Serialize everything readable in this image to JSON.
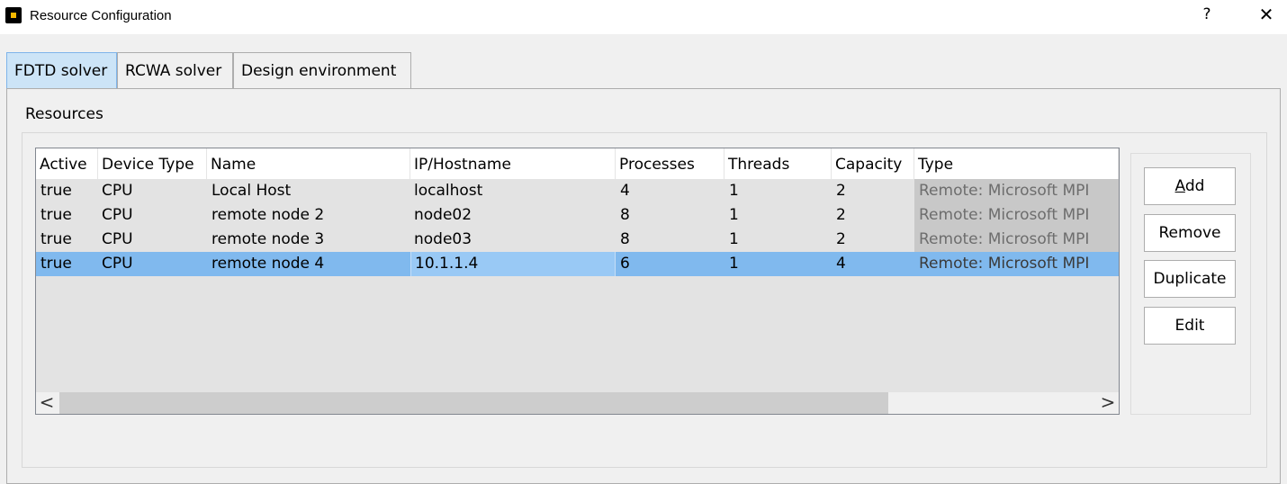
{
  "window": {
    "title": "Resource Configuration",
    "help_label": "?",
    "close_label": "✕"
  },
  "tabs": [
    {
      "label": "FDTD solver",
      "active": true
    },
    {
      "label": "RCWA solver",
      "active": false
    },
    {
      "label": "Design environment",
      "active": false
    }
  ],
  "section": {
    "label": "Resources"
  },
  "table": {
    "columns": [
      "Active",
      "Device Type",
      "Name",
      "IP/Hostname",
      "Processes",
      "Threads",
      "Capacity",
      "Type"
    ],
    "rows": [
      [
        "true",
        "CPU",
        "Local Host",
        "localhost",
        "4",
        "1",
        "2",
        "Remote: Microsoft MPI"
      ],
      [
        "true",
        "CPU",
        "remote node 2",
        "node02",
        "8",
        "1",
        "2",
        "Remote: Microsoft MPI"
      ],
      [
        "true",
        "CPU",
        "remote node 3",
        "node03",
        "8",
        "1",
        "2",
        "Remote: Microsoft MPI"
      ],
      [
        "true",
        "CPU",
        "remote node 4",
        "10.1.1.4",
        "6",
        "1",
        "4",
        "Remote: Microsoft MPI"
      ]
    ],
    "selected_row": 3,
    "scroll": {
      "left_label": "<",
      "right_label": ">",
      "thumb_fraction": 0.8
    }
  },
  "buttons": {
    "add_mnemonic": "A",
    "add_rest": "dd",
    "remove": "Remove",
    "duplicate": "Duplicate",
    "edit": "Edit"
  }
}
